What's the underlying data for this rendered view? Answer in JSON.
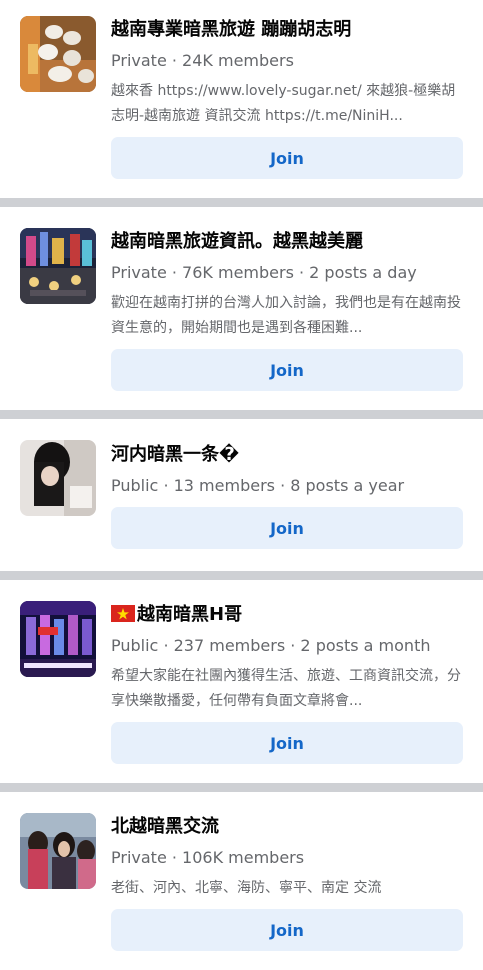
{
  "groups": [
    {
      "name": "越南專業暗黑旅遊 蹦蹦胡志明",
      "flag": "",
      "meta": "Private · 24K members",
      "description": "越來香 https://www.lovely-sugar.net/ 來越狼-極樂胡志明-越南旅遊 資訊交流 https://t.me/NiniH...",
      "join_label": "Join"
    },
    {
      "name": "越南暗黑旅遊資訊。越黑越美麗",
      "flag": "",
      "meta": "Private · 76K members · 2 posts a day",
      "description": "歡迎在越南打拼的台灣人加入討論，我們也是有在越南投資生意的，開始期間也是遇到各種困難...",
      "join_label": "Join"
    },
    {
      "name": "河内暗黑一条�",
      "flag": "",
      "meta": "Public · 13 members · 8 posts a year",
      "description": "",
      "join_label": "Join"
    },
    {
      "name": "越南暗黑H哥",
      "flag": "vietnam-flag",
      "meta": "Public · 237 members · 2 posts a month",
      "description": "希望大家能在社團內獲得生活、旅遊、工商資訊交流，分享快樂散播愛，任何帶有負面文章將會...",
      "join_label": "Join"
    },
    {
      "name": "北越暗黑交流",
      "flag": "",
      "meta": "Private · 106K members",
      "description": "老街、河內、北寧、海防、寧平、南定 交流",
      "join_label": "Join"
    }
  ],
  "colors": {
    "background": "#ffffff",
    "divider": "#ced0d4",
    "title": "#050505",
    "secondary_text": "#65676b",
    "join_button_bg": "#e7f0fb",
    "join_button_text": "#1467c8"
  }
}
